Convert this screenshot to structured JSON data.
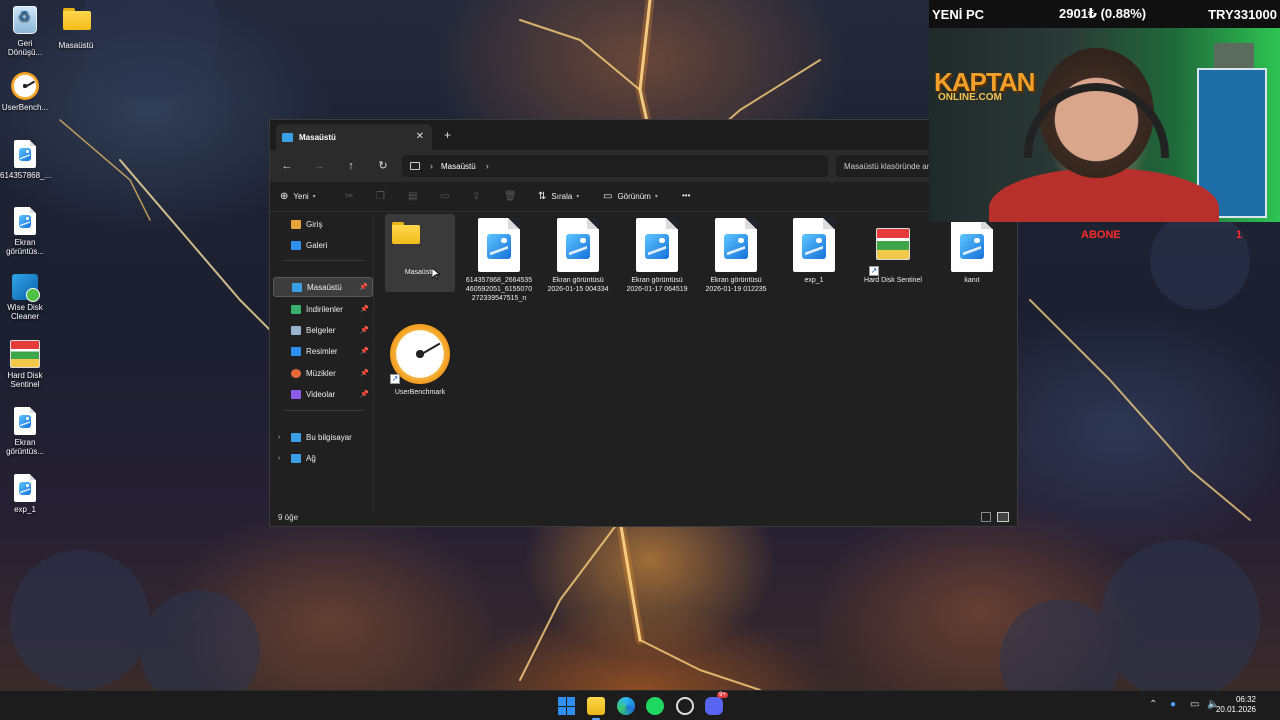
{
  "desktop": {
    "icons": [
      {
        "label": "Geri Dönüşü...",
        "icon": "recycle-bin-icon"
      },
      {
        "label": "Masaüstü",
        "icon": "folder-icon"
      },
      {
        "label": "UserBench...",
        "icon": "userbenchmark-icon"
      },
      {
        "label": "614357868_...",
        "icon": "image-file-icon"
      },
      {
        "label": "Ekran görüntüs...",
        "icon": "image-file-icon"
      },
      {
        "label": "Wise Disk Cleaner",
        "icon": "wise-disk-cleaner-icon"
      },
      {
        "label": "Hard Disk Sentinel",
        "icon": "hard-disk-sentinel-icon"
      },
      {
        "label": "Ekran görüntüs...",
        "icon": "image-file-icon"
      },
      {
        "label": "exp_1",
        "icon": "image-file-icon"
      }
    ]
  },
  "explorer": {
    "tab_title": "Masaüstü",
    "nav": {
      "back": "←",
      "forward": "→",
      "up": "↑",
      "refresh": "↻",
      "breadcrumb": "Masaüstü",
      "search_placeholder": "Masaüstü klasöründe ara"
    },
    "toolbar": {
      "new_label": "Yeni",
      "sort_label": "Sırala",
      "view_label": "Görünüm",
      "more": "•••"
    },
    "sidebar": {
      "top": [
        {
          "label": "Giriş",
          "icon": "home-icon",
          "color": "#e8a23a"
        },
        {
          "label": "Galeri",
          "icon": "gallery-icon",
          "color": "#2f8ff0"
        }
      ],
      "pinned": [
        {
          "label": "Masaüstü",
          "icon": "desktop-icon",
          "color": "#3aa0e6",
          "selected": true
        },
        {
          "label": "İndirilenler",
          "icon": "download-icon",
          "color": "#37b06b"
        },
        {
          "label": "Belgeler",
          "icon": "documents-icon",
          "color": "#9ab3cf"
        },
        {
          "label": "Resimler",
          "icon": "pictures-icon",
          "color": "#2f8ff0"
        },
        {
          "label": "Müzikler",
          "icon": "music-icon",
          "color": "#e8683a"
        },
        {
          "label": "Videolar",
          "icon": "videos-icon",
          "color": "#8b5be8"
        }
      ],
      "bottom": [
        {
          "label": "Bu bilgisayar",
          "icon": "this-pc-icon",
          "color": "#3aa0e6"
        },
        {
          "label": "Ağ",
          "icon": "network-icon",
          "color": "#3aa0e6"
        }
      ]
    },
    "files": [
      {
        "name": "Masaüstü",
        "type": "folder",
        "selected": true
      },
      {
        "name": "614357868_2664535460592051_6155070272339547515_n",
        "type": "image"
      },
      {
        "name": "Ekran görüntüsü 2026-01-15 004334",
        "type": "image"
      },
      {
        "name": "Ekran görüntüsü 2026-01-17 064519",
        "type": "image"
      },
      {
        "name": "Ekran görüntüsü 2026-01-19 012235",
        "type": "image"
      },
      {
        "name": "exp_1",
        "type": "image"
      },
      {
        "name": "Hard Disk Sentinel",
        "type": "shortcut-hds"
      },
      {
        "name": "kanıt",
        "type": "image"
      },
      {
        "name": "UserBenchmark",
        "type": "shortcut-gauge"
      }
    ],
    "status": "9 öğe"
  },
  "overlay": {
    "title": "YENİ PC",
    "price": "2901₺ (0.88%)",
    "target": "TRY331000",
    "logo": "KAPTAN",
    "logo_sub": "ONLINE.COM",
    "abone_label": "ABONE",
    "abone_count": "1"
  },
  "taskbar": {
    "apps": [
      "start-icon",
      "file-explorer-icon",
      "edge-icon",
      "spotify-icon",
      "chatgpt-icon",
      "discord-icon"
    ],
    "discord_badge": "9+",
    "time": "06:32",
    "date": "20.01.2026"
  }
}
